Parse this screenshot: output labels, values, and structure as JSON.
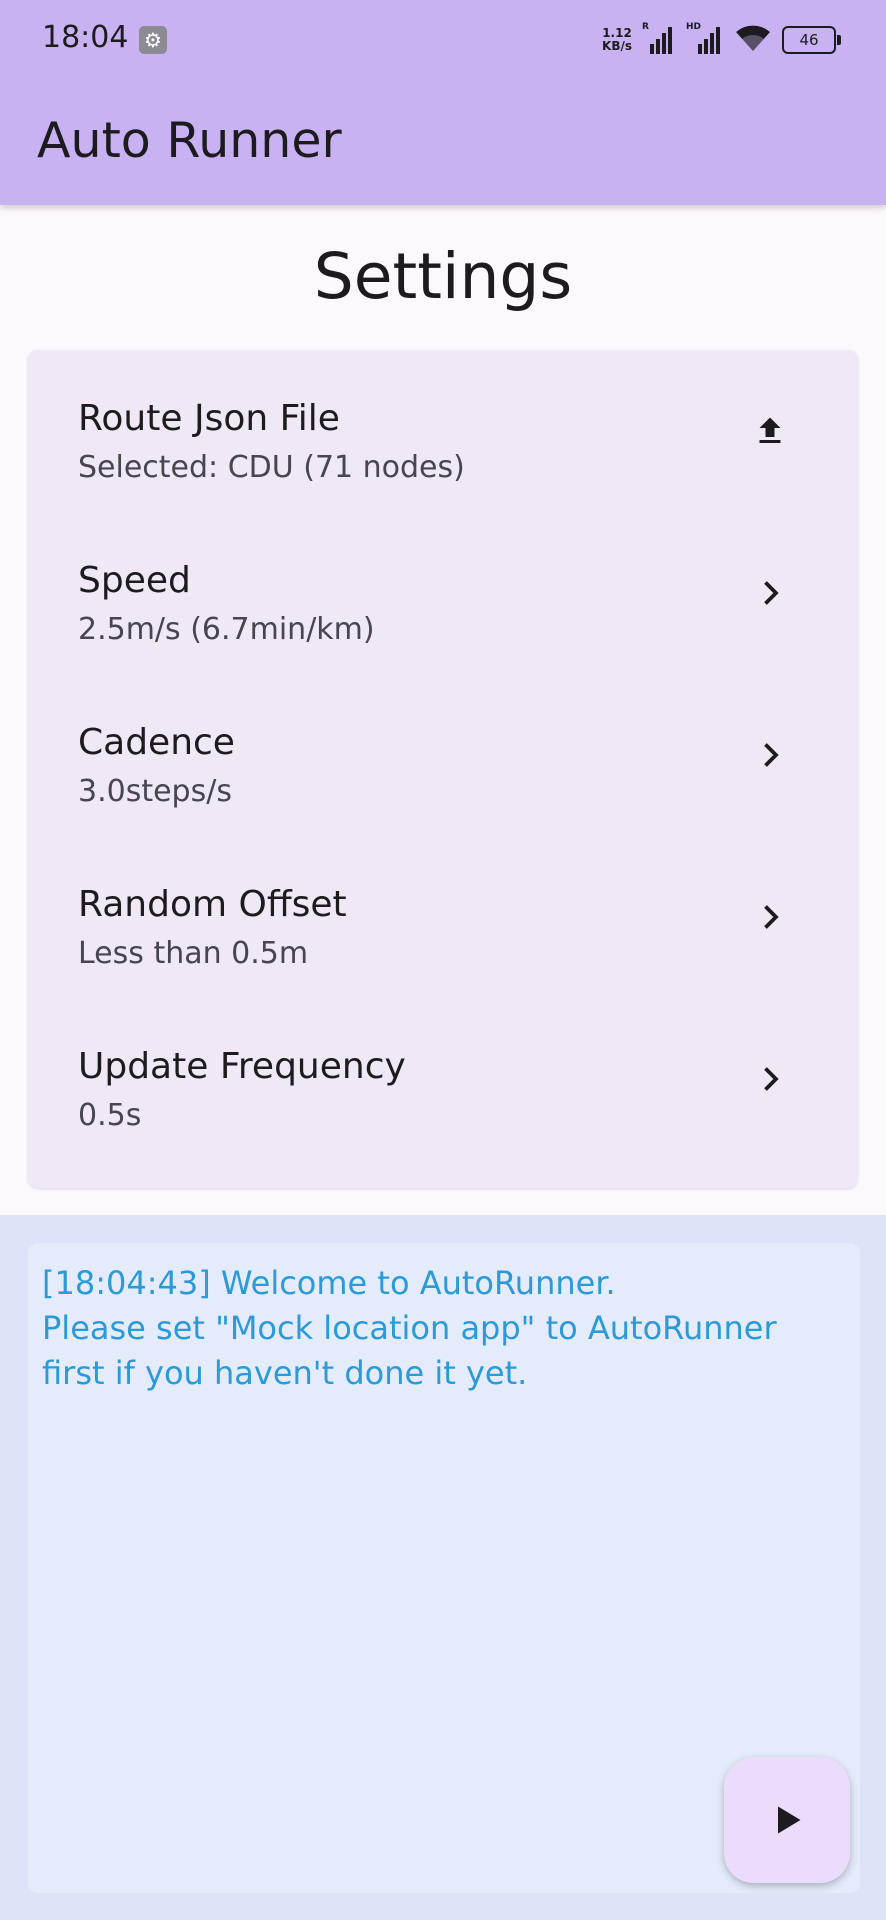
{
  "status_bar": {
    "time": "18:04",
    "net_speed_value": "1.12",
    "net_speed_unit": "KB/s",
    "signal_1_label": "R",
    "signal_2_label": "HD",
    "battery": "46"
  },
  "app_bar": {
    "title": "Auto Runner"
  },
  "page": {
    "title": "Settings"
  },
  "settings": {
    "items": [
      {
        "title": "Route Json File",
        "subtitle": "Selected: CDU (71 nodes)",
        "icon": "upload-icon"
      },
      {
        "title": "Speed",
        "subtitle": "2.5m/s (6.7min/km)",
        "icon": "chevron-right-icon"
      },
      {
        "title": "Cadence",
        "subtitle": "3.0steps/s",
        "icon": "chevron-right-icon"
      },
      {
        "title": "Random Offset",
        "subtitle": "Less than 0.5m",
        "icon": "chevron-right-icon"
      },
      {
        "title": "Update Frequency",
        "subtitle": "0.5s",
        "icon": "chevron-right-icon"
      }
    ]
  },
  "console": {
    "log": "[18:04:43] Welcome to AutoRunner.\nPlease set \"Mock location app\" to AutoRunner first if you haven't done it yet."
  },
  "colors": {
    "app_bar": "#c9b2f2",
    "background": "#fdf7fe",
    "card": "#f0e8f5",
    "console_text": "#2d9ad8",
    "fab": "#ecdcfb"
  }
}
